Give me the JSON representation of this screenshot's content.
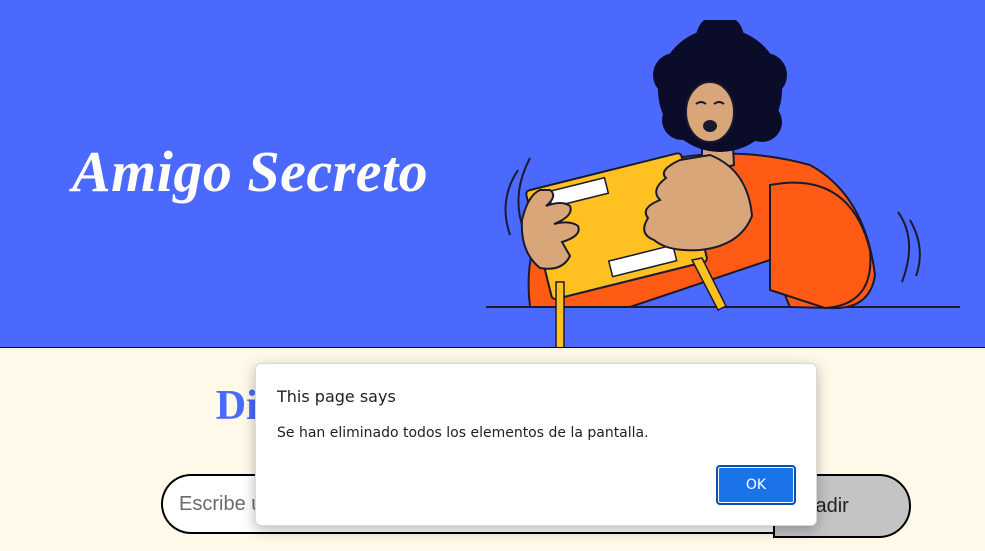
{
  "header": {
    "title": "Amigo Secreto",
    "illustration": "person-shaking-gift-box"
  },
  "main": {
    "section_title": "Digite el nombre de sus amigos",
    "input": {
      "placeholder": "Escribe un nombre",
      "value": ""
    },
    "add_button_label": "Añadir"
  },
  "dialog": {
    "title": "This page says",
    "message": "Se han eliminado todos los elementos de la pantalla.",
    "ok_label": "OK"
  },
  "colors": {
    "banner_bg": "#4b69fd",
    "page_bg": "#fff9ea",
    "accent": "#4b69fd",
    "button_bg": "#c4c4c4",
    "dialog_ok": "#1a73e8"
  }
}
